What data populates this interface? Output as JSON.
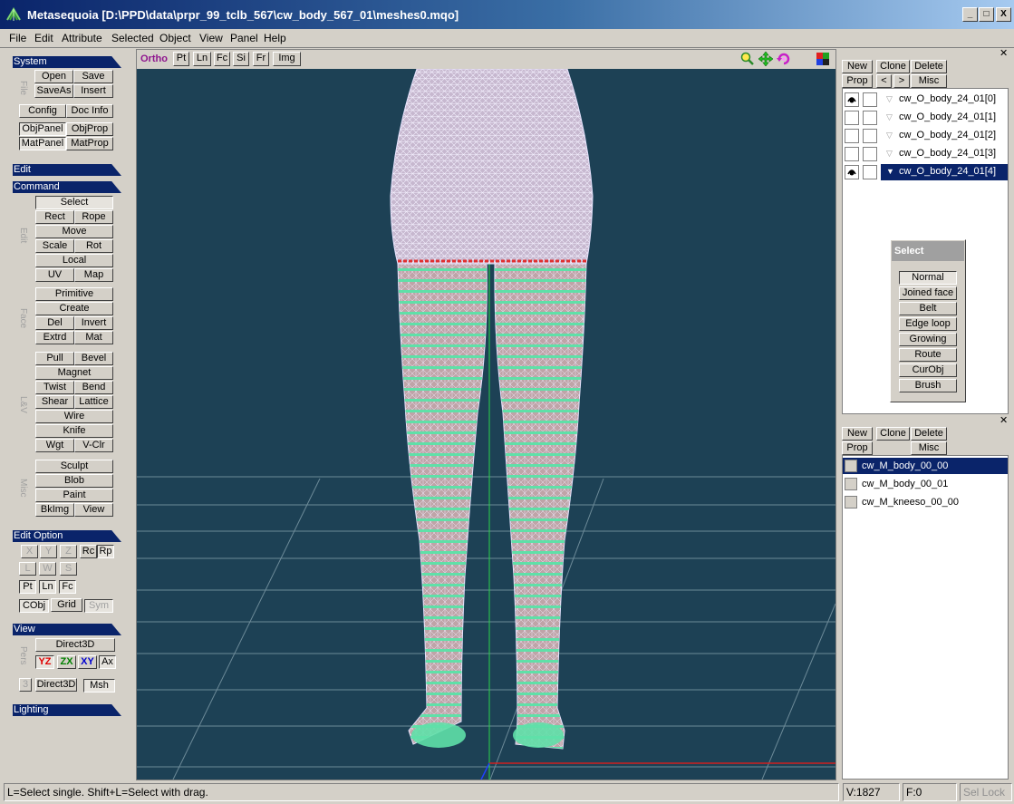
{
  "titlebar": {
    "title": "Metasequoia [D:\\PPD\\data\\prpr_99_tclb_567\\cw_body_567_01\\meshes0.mqo]",
    "minimize": "_",
    "maximize": "□",
    "close": "X"
  },
  "menu": [
    "File",
    "Edit",
    "Attribute",
    "Selected",
    "Object",
    "View",
    "Panel",
    "Help"
  ],
  "left": {
    "system": {
      "header": "System",
      "file_label": "File",
      "open": "Open",
      "save": "Save",
      "saveas": "SaveAs",
      "insert": "Insert",
      "config": "Config",
      "docinfo": "Doc Info",
      "objpanel": "ObjPanel",
      "objprop": "ObjProp",
      "matpanel": "MatPanel",
      "matprop": "MatProp"
    },
    "edit_header": "Edit",
    "command": {
      "header": "Command",
      "edit_label": "Edit",
      "select": "Select",
      "rect": "Rect",
      "rope": "Rope",
      "move": "Move",
      "scale": "Scale",
      "rot": "Rot",
      "local": "Local",
      "uv": "UV",
      "map": "Map",
      "face_label": "Face",
      "primitive": "Primitive",
      "create": "Create",
      "del": "Del",
      "invert": "Invert",
      "extrd": "Extrd",
      "mat": "Mat",
      "lv_label": "L&V",
      "pull": "Pull",
      "bevel": "Bevel",
      "magnet": "Magnet",
      "twist": "Twist",
      "bend": "Bend",
      "shear": "Shear",
      "lattice": "Lattice",
      "wire": "Wire",
      "knife": "Knife",
      "wgt": "Wgt",
      "vclr": "V-Clr",
      "misc_label": "Misc",
      "sculpt": "Sculpt",
      "blob": "Blob",
      "paint": "Paint",
      "bkimg": "BkImg",
      "view": "View"
    },
    "editoption": {
      "header": "Edit Option",
      "x": "X",
      "y": "Y",
      "z": "Z",
      "rc": "Rc",
      "rp": "Rp",
      "l": "L",
      "w": "W",
      "s": "S",
      "pt": "Pt",
      "ln": "Ln",
      "fc": "Fc",
      "cobj": "CObj",
      "grid": "Grid",
      "sym": "Sym"
    },
    "view": {
      "header": "View",
      "pers_label": "Pers",
      "d3d": "Direct3D",
      "yz": "YZ",
      "zx": "ZX",
      "xy": "XY",
      "ax": "Ax",
      "three_label": "3",
      "d3d2": "Direct3D",
      "msh": "Msh"
    },
    "lighting_header": "Lighting"
  },
  "viewport": {
    "ortho": "Ortho",
    "buttons": [
      "Pt",
      "Ln",
      "Fc",
      "Si",
      "Fr",
      "Img"
    ],
    "tools": [
      "zoom-icon",
      "move-view-icon",
      "rotate-view-icon",
      "color-icon"
    ]
  },
  "objpanel": {
    "new": "New",
    "clone": "Clone",
    "delete": "Delete",
    "prop": "Prop",
    "prev": "<",
    "next": ">",
    "misc": "Misc",
    "objects": [
      {
        "name": "cw_O_body_24_01[0]",
        "visible": true
      },
      {
        "name": "cw_O_body_24_01[1]",
        "visible": false
      },
      {
        "name": "cw_O_body_24_01[2]",
        "visible": false
      },
      {
        "name": "cw_O_body_24_01[3]",
        "visible": false
      },
      {
        "name": "cw_O_body_24_01[4]",
        "visible": true
      }
    ]
  },
  "selectpanel": {
    "title": "Select",
    "items": [
      "Normal",
      "Joined face",
      "Belt",
      "Edge loop",
      "Growing",
      "Route",
      "CurObj",
      "Brush"
    ]
  },
  "matpanel": {
    "new": "New",
    "clone": "Clone",
    "delete": "Delete",
    "prop": "Prop",
    "misc": "Misc",
    "materials": [
      "cw_M_body_00_00",
      "cw_M_body_00_01",
      "cw_M_kneeso_00_00"
    ]
  },
  "status": {
    "hint": "L=Select single.  Shift+L=Select with drag.",
    "vertices": "V:1827",
    "faces": "F:0",
    "sellock": "Sel Lock"
  },
  "colors": {
    "title_start": "#0a246a",
    "viewport_bg": "#1d4155",
    "mesh": "#b9b0e6",
    "vertex": "#5fe0a8",
    "selection": "#0a246a"
  }
}
